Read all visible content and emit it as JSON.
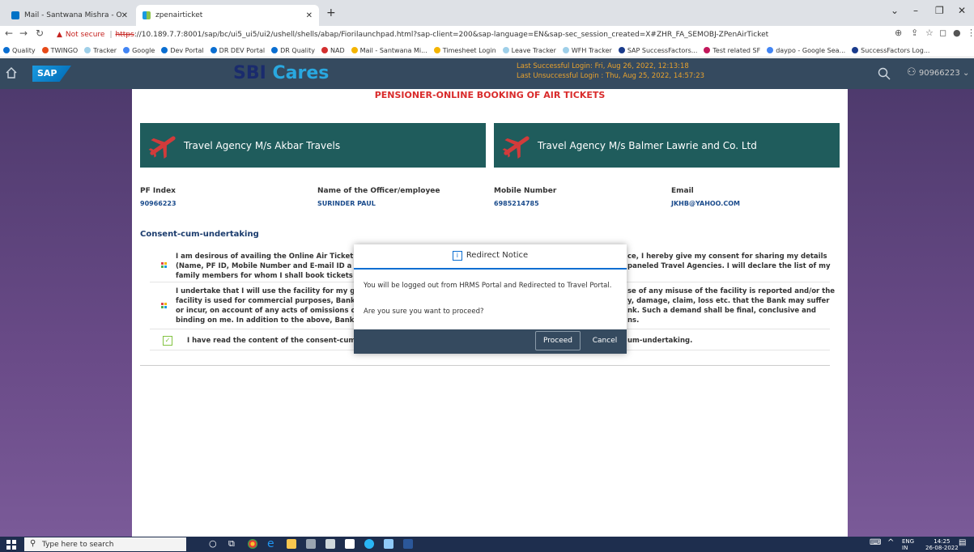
{
  "browser": {
    "tabs": [
      {
        "title": "Mail - Santwana Mishra - Outloo",
        "active": false
      },
      {
        "title": "zpenairticket",
        "active": true
      }
    ],
    "url_prefix": "Not secure",
    "url_scheme": "https",
    "url_rest": "://10.189.7.7:8001/sap/bc/ui5_ui5/ui2/ushell/shells/abap/Fiorilaunchpad.html?sap-client=200&sap-language=EN&sap-sec_session_created=X#ZHR_FA_SEMOBJ-ZPenAirTicket",
    "bookmarks": [
      "Quality",
      "TWINGO",
      "Tracker",
      "Google",
      "Dev Portal",
      "DR DEV Portal",
      "DR Quality",
      "NAD",
      "Mail - Santwana Mi...",
      "Timesheet Login",
      "Leave Tracker",
      "WFH Tracker",
      "SAP SuccessFactors...",
      "Test related SF",
      "daypo - Google Sea...",
      "SuccessFactors Log..."
    ]
  },
  "shell": {
    "brand_a": "SBI",
    "brand_b": " Cares",
    "last_success": "Last Successful Login: Fri, Aug 26, 2022, 12:13:18",
    "last_unsuccess": "Last Unsuccessful Login : Thu, Aug 25, 2022, 14:57:23",
    "user_id": "90966223"
  },
  "page": {
    "heading": "PENSIONER-ONLINE BOOKING OF AIR TICKETS",
    "agencies": [
      "Travel Agency M/s Akbar Travels",
      "Travel Agency M/s Balmer Lawrie and Co. Ltd"
    ],
    "fields": [
      {
        "label": "PF Index",
        "value": "90966223"
      },
      {
        "label": "Name of the Officer/employee",
        "value": "SURINDER PAUL"
      },
      {
        "label": "Mobile Number",
        "value": "6985214785"
      },
      {
        "label": "Email",
        "value": "JKHB@YAHOO.COM"
      }
    ],
    "section_title": "Consent-cum-undertaking",
    "row1": {
      "left": [
        "I am desirous of availing the Online Air Ticket",
        "(Name, PF ID, Mobile Number and E-mail ID a",
        "family members for whom I shall book tickets"
      ],
      "right": [
        "ce, I hereby give my consent for sharing my details",
        "paneled Travel Agencies. I will declare the list of my"
      ]
    },
    "row2": {
      "left": [
        "I undertake that I will use the facility for my g",
        "facility is used for commercial purposes, Bank",
        "or incur, on account of any acts of omissions c",
        "binding on me. In addition to the above, Bank"
      ],
      "right": [
        "se of any misuse of the facility is reported and/or the",
        "y, damage, claim, loss etc. that the Bank may suffer",
        "nk. Such a demand shall be final, conclusive and",
        "ns."
      ]
    },
    "row3": {
      "left": "I have read the content of the consent-cum-u",
      "right": "um-undertaking."
    }
  },
  "dialog": {
    "title": "Redirect Notice",
    "message": "You will be logged out from HRMS Portal and Redirected to Travel Portal.",
    "question": "Are you sure you want to proceed?",
    "proceed": "Proceed",
    "cancel": "Cancel"
  },
  "taskbar": {
    "search_placeholder": "Type here to search",
    "lang": "ENG",
    "region": "IN",
    "time": "14:25",
    "date": "26-08-2022"
  }
}
